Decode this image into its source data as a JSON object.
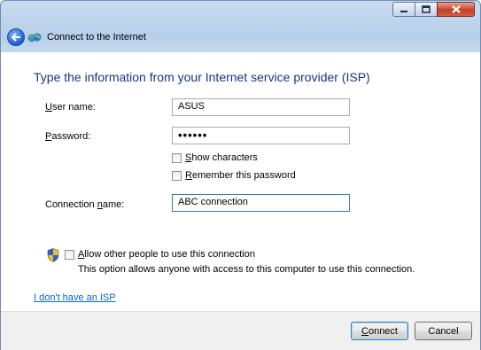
{
  "window": {
    "title": "Connect to the Internet",
    "controls": [
      "minimize-icon",
      "maximize-icon",
      "close-icon"
    ]
  },
  "main": {
    "heading": "Type the information from your Internet service provider (ISP)",
    "username": {
      "label": "User name:",
      "value": "ASUS"
    },
    "password": {
      "label": "Password:",
      "value": "••••••"
    },
    "show_characters": {
      "label": "Show characters",
      "checked": false
    },
    "remember_password": {
      "label": "Remember this password",
      "checked": false
    },
    "connection_name": {
      "label": "Connection name:",
      "value": "ABC connection"
    },
    "allow_others": {
      "label": "Allow other people to use this connection",
      "checked": false,
      "description": "This option allows anyone with access to this computer to use this connection."
    },
    "no_isp_link": "I don't have an ISP"
  },
  "footer": {
    "connect_label": "Connect",
    "cancel_label": "Cancel"
  },
  "colors": {
    "heading": "#1e3287",
    "link": "#0066cc",
    "close_button": "#c2412a"
  }
}
